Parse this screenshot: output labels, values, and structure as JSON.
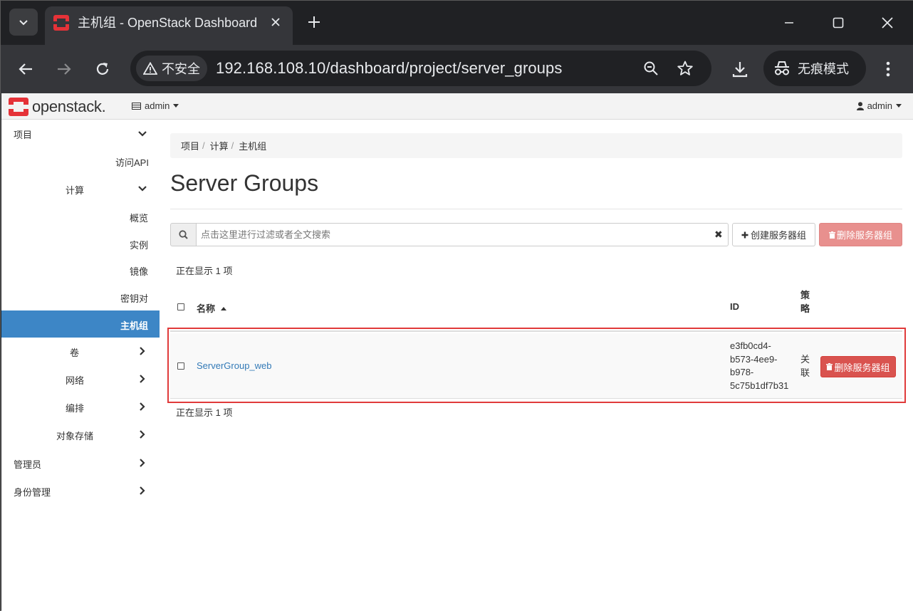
{
  "browser": {
    "tab_title": "主机组 - OpenStack Dashboard",
    "security_label": "不安全",
    "url": "192.168.108.10/dashboard/project/server_groups",
    "incognito_label": "无痕模式"
  },
  "topnav": {
    "brand": "openstack.",
    "project": "admin",
    "user": "admin"
  },
  "sidebar": {
    "project": "项目",
    "api_access": "访问API",
    "compute": "计算",
    "overview": "概览",
    "instances": "实例",
    "images": "镜像",
    "key_pairs": "密钥对",
    "server_groups": "主机组",
    "volumes": "卷",
    "network": "网络",
    "orchestration": "编排",
    "object_store": "对象存储",
    "admin": "管理员",
    "identity": "身份管理"
  },
  "breadcrumb": [
    "项目",
    "计算",
    "主机组"
  ],
  "page_title": "Server Groups",
  "search": {
    "placeholder": "点击这里进行过滤或者全文搜索"
  },
  "actions": {
    "create": "创建服务器组",
    "delete": "删除服务器组"
  },
  "count_text": "正在显示 1 项",
  "table": {
    "columns": {
      "name": "名称",
      "id": "ID",
      "policy_line1": "策",
      "policy_line2": "略"
    },
    "rows": [
      {
        "name": "ServerGroup_web",
        "id_lines": [
          "e3fb0cd4-",
          "b573-4ee9-",
          "b978-",
          "5c75b1df7b31"
        ],
        "policy_lines": [
          "关",
          "联"
        ],
        "action": "删除服务器组"
      }
    ]
  },
  "colors": {
    "accent": "#3d86c6",
    "danger": "#d9534f",
    "link": "#337ab7",
    "highlight": "#e03a3a"
  }
}
